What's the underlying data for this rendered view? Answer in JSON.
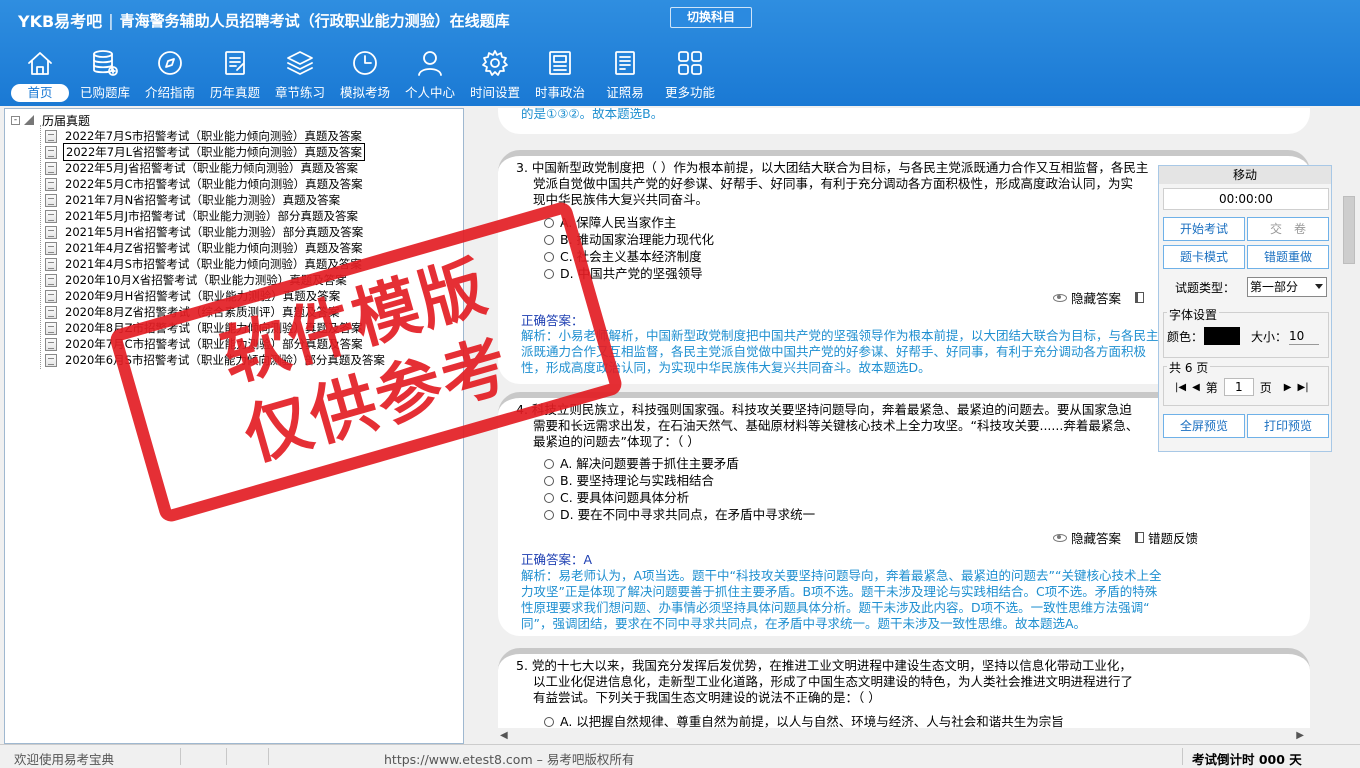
{
  "header": {
    "brand": "YKB易考吧",
    "separator": "|",
    "title": "青海警务辅助人员招聘考试（行政职业能力测验）在线题库",
    "switch_button": "切换科目"
  },
  "nav": [
    {
      "label": "首页",
      "icon": "home-icon"
    },
    {
      "label": "已购题库",
      "icon": "database-icon"
    },
    {
      "label": "介绍指南",
      "icon": "compass-icon"
    },
    {
      "label": "历年真题",
      "icon": "document-icon"
    },
    {
      "label": "章节练习",
      "icon": "layers-icon"
    },
    {
      "label": "模拟考场",
      "icon": "clock-icon"
    },
    {
      "label": "个人中心",
      "icon": "user-icon"
    },
    {
      "label": "时间设置",
      "icon": "gear-icon"
    },
    {
      "label": "时事政治",
      "icon": "newspaper-icon"
    },
    {
      "label": "证照易",
      "icon": "certificate-icon"
    },
    {
      "label": "更多功能",
      "icon": "grid-icon"
    }
  ],
  "tree": {
    "expander": "-",
    "root": "历届真题",
    "items": [
      "2022年7月S市招警考试（职业能力倾向测验）真题及答案",
      "2022年7月L省招警考试（职业能力倾向测验）真题及答案",
      "2022年5月J省招警考试（职业能力倾向测验）真题及答案",
      "2022年5月C市招警考试（职业能力倾向测验）真题及答案",
      "2021年7月N省招警考试（职业能力测验）真题及答案",
      "2021年5月J市招警考试（职业能力测验）部分真题及答案",
      "2021年5月H省招警考试（职业能力测验）部分真题及答案",
      "2021年4月Z省招警考试（职业能力倾向测验）真题及答案",
      "2021年4月S市招警考试（职业能力倾向测验）真题及答案",
      "2020年10月X省招警考试（职业能力测验）真题及答案",
      "2020年9月H省招警考试（职业能力测验）真题及答案",
      "2020年8月Z省招警考试（综合素质测评）真题及答案",
      "2020年8月Z市招警考试（职业能力倾向测验）真题及答案",
      "2020年7月C市招警考试（职业能力测验）部分真题及答案",
      "2020年6月S市招警考试（职业能力倾向测验）部分真题及答案"
    ]
  },
  "stamp": {
    "line1": "软件模版",
    "line2": "仅供参考"
  },
  "questions": {
    "q2_tail": "的是①③②。故本题选B。",
    "q3": {
      "line1": "3. 中国新型政党制度把（ ）作为根本前提，以大团结大联合为目标，与各民主党派既通力合作又互相监督，各民主",
      "line2": "党派自觉做中国共产党的好参谋、好帮手、好同事，有利于充分调动各方面积极性，形成高度政治认同，为实",
      "line3": "现中华民族伟大复兴共同奋斗。",
      "options": [
        "A. 保障人民当家作主",
        "B. 推动国家治理能力现代化",
        "C. 社会主义基本经济制度",
        "D. 中国共产党的坚强领导"
      ],
      "answer": "正确答案：",
      "exp1": "解析：小易老师解析，中国新型政党制度把中国共产党的坚强领导作为根本前提，以大团结大联合为目标，与各民主党",
      "exp2": "派既通力合作又互相监督，各民主党派自觉做中国共产党的好参谋、好帮手、好同事，有利于充分调动各方面积极",
      "exp3": "性，形成高度政治认同，为实现中华民族伟大复兴共同奋斗。故本题选D。"
    },
    "q4": {
      "line1": "4. 科技立则民族立，科技强则国家强。科技攻关要坚持问题导向，奔着最紧急、最紧迫的问题去。要从国家急迫",
      "line2": "需要和长远需求出发，在石油天然气、基础原材料等关键核心技术上全力攻坚。“科技攻关要......奔着最紧急、",
      "line3": "最紧迫的问题去”体现了：（ ）",
      "options": [
        "A. 解决问题要善于抓住主要矛盾",
        "B. 要坚持理论与实践相结合",
        "C. 要具体问题具体分析",
        "D. 要在不同中寻求共同点，在矛盾中寻求统一"
      ],
      "answer": "正确答案：A",
      "exp1": "解析：易老师认为，A项当选。题干中“科技攻关要坚持问题导向，奔着最紧急、最紧迫的问题去”“关键核心技术上全",
      "exp2": "力攻坚”正是体现了解决问题要善于抓住主要矛盾。B项不选。题干未涉及理论与实践相结合。C项不选。矛盾的特殊",
      "exp3": "性原理要求我们想问题、办事情必须坚持具体问题具体分析。题干未涉及此内容。D项不选。一致性思维方法强调“",
      "exp4": "同”，强调团结，要求在不同中寻求共同点，在矛盾中寻求统一。题干未涉及一致性思维。故本题选A。"
    },
    "q5": {
      "line1": "5. 党的十七大以来，我国充分发挥后发优势，在推进工业文明进程中建设生态文明，坚持以信息化带动工业化，",
      "line2": "以工业化促进信息化，走新型工业化道路，形成了中国生态文明建设的特色，为人类社会推进文明进程进行了",
      "line3": "有益尝试。下列关于我国生态文明建设的说法不正确的是：（ ）",
      "options": [
        "A. 以把握自然规律、尊重自然为前提，以人与自然、环境与经济、人与社会和谐共生为宗旨"
      ]
    },
    "hide_answer": "隐藏答案",
    "error_feedback": "错题反馈"
  },
  "panel": {
    "title": "移动",
    "timer": "00:00:00",
    "start_exam": "开始考试",
    "submit": "交　卷",
    "card_mode": "题卡模式",
    "redo_wrong": "错题重做",
    "type_label": "试题类型：",
    "type_value": "第一部分",
    "font_settings": "字体设置",
    "color_label": "颜色：",
    "size_label": "大小：",
    "size_value": "10",
    "pages_label": "共 6 页",
    "page_prefix": "第",
    "page_value": "1",
    "page_suffix": "页",
    "fullscreen_preview": "全屏预览",
    "print_preview": "打印预览",
    "text_color": "#000000"
  },
  "status": {
    "welcome": "欢迎使用易考宝典",
    "copyright": "https://www.etest8.com – 易考吧版权所有",
    "countdown": "考试倒计时 000 天"
  }
}
